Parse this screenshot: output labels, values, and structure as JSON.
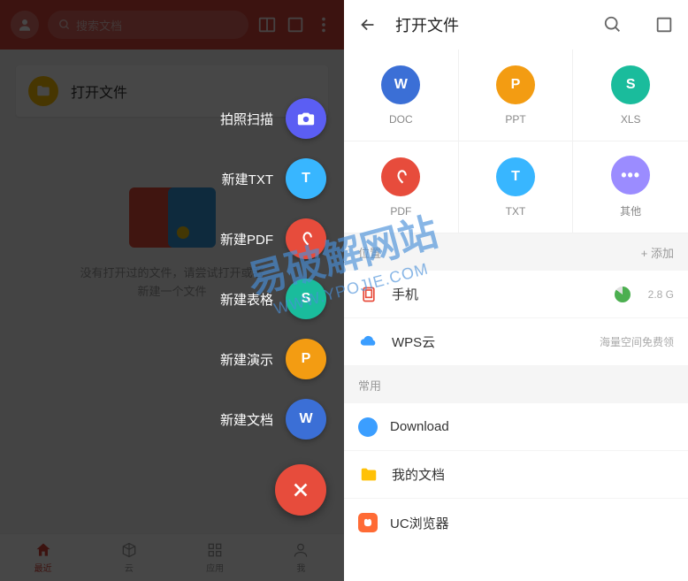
{
  "left": {
    "search_placeholder": "搜索文档",
    "open_file": "打开文件",
    "empty_line1": "没有打开过的文件，请尝试打开或者",
    "empty_line2": "新建一个文件",
    "nav": [
      "最近",
      "云",
      "应用",
      "我"
    ],
    "fab": [
      {
        "label": "拍照扫描",
        "color": "#5b5ef3",
        "glyph": "camera"
      },
      {
        "label": "新建TXT",
        "color": "#38b6ff",
        "glyph": "T"
      },
      {
        "label": "新建PDF",
        "color": "#e74c3c",
        "glyph": "P"
      },
      {
        "label": "新建表格",
        "color": "#1abc9c",
        "glyph": "S"
      },
      {
        "label": "新建演示",
        "color": "#f39c12",
        "glyph": "P"
      },
      {
        "label": "新建文档",
        "color": "#3b6fd6",
        "glyph": "W"
      }
    ]
  },
  "right": {
    "title": "打开文件",
    "file_types": [
      {
        "label": "DOC",
        "color": "#3b6fd6",
        "glyph": "W"
      },
      {
        "label": "PPT",
        "color": "#f39c12",
        "glyph": "P"
      },
      {
        "label": "XLS",
        "color": "#1abc9c",
        "glyph": "S"
      },
      {
        "label": "PDF",
        "color": "#e74c3c",
        "glyph": "P"
      },
      {
        "label": "TXT",
        "color": "#38b6ff",
        "glyph": "T"
      },
      {
        "label": "其他",
        "color": "#9b8cff",
        "glyph": "•••"
      }
    ],
    "loc_header": "位置",
    "loc_add": "+ 添加",
    "locations": [
      {
        "label": "手机",
        "icon_color": "#e74c3c",
        "sub": "2.8 G"
      },
      {
        "label": "WPS云",
        "icon_color": "#3b9eff",
        "sub": "海量空间免费领"
      }
    ],
    "common_header": "常用",
    "common": [
      {
        "label": "Download",
        "icon_color": "#3b9eff"
      },
      {
        "label": "我的文档",
        "icon_color": "#ffc107"
      },
      {
        "label": "UC浏览器",
        "icon_color": "#ff6b35"
      }
    ]
  },
  "watermark": {
    "line1": "易破解网站",
    "line2": "WWW.YPOJIE.COM"
  }
}
